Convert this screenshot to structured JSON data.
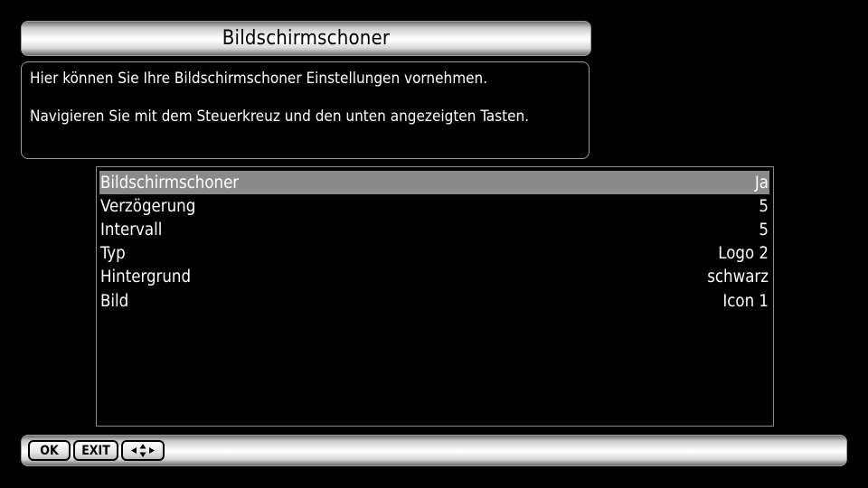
{
  "title": "Bildschirmschoner",
  "info": {
    "line1": "Hier können Sie Ihre Bildschirmschoner Einstellungen vornehmen.",
    "line2": "Navigieren Sie mit dem Steuerkreuz und den unten angezeigten Tasten."
  },
  "settings": [
    {
      "label": "Bildschirmschoner",
      "value": "Ja"
    },
    {
      "label": "Verzögerung",
      "value": "5"
    },
    {
      "label": "Intervall",
      "value": "5"
    },
    {
      "label": "Typ",
      "value": "Logo 2"
    },
    {
      "label": "Hintergrund",
      "value": "schwarz"
    },
    {
      "label": "Bild",
      "value": "Icon 1"
    }
  ],
  "selected_index": 0,
  "footer": {
    "ok_label": "OK",
    "exit_label": "EXIT",
    "nav_icon": "dpad-arrows-icon"
  },
  "colors": {
    "background": "#000000",
    "selection": "#8a8a8a",
    "text": "#ffffff"
  }
}
